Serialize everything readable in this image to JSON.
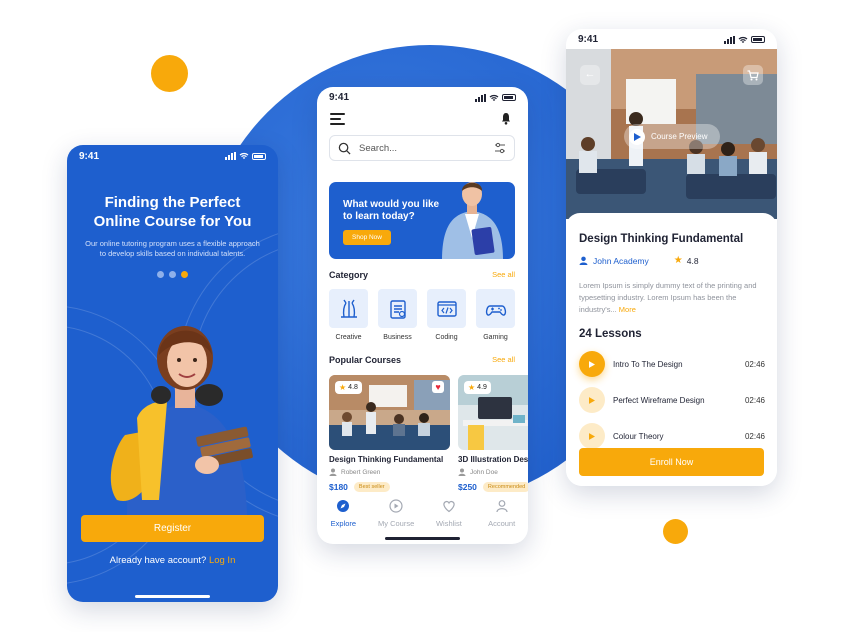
{
  "status_time": "9:41",
  "colors": {
    "brand_blue": "#1e5fce",
    "accent_orange": "#f8a90b"
  },
  "onboarding": {
    "title_line1": "Finding the Perfect",
    "title_line2": "Online Course for You",
    "description": "Our online tutoring program uses a flexible approach to develop skills based on individual talents.",
    "pager": {
      "count": 3,
      "active_index": 2
    },
    "register_label": "Register",
    "login_prompt": "Already have account?",
    "login_link": "Log In"
  },
  "explore": {
    "search_placeholder": "Search...",
    "banner": {
      "title": "What would you like to learn today?",
      "button": "Shop Now"
    },
    "category_title": "Category",
    "see_all": "See all",
    "categories": [
      {
        "label": "Creative",
        "icon": "palette-icon"
      },
      {
        "label": "Business",
        "icon": "briefcase-icon"
      },
      {
        "label": "Coding",
        "icon": "code-icon"
      },
      {
        "label": "Gaming",
        "icon": "gamepad-icon"
      }
    ],
    "popular_title": "Popular Courses",
    "courses": [
      {
        "title": "Design Thinking Fundamental",
        "author": "Robert Green",
        "price": "$180",
        "rating": "4.8",
        "tag": "Best seller"
      },
      {
        "title": "3D Illustration Design",
        "author": "John Doe",
        "price": "$250",
        "rating": "4.9",
        "tag": "Recommended"
      }
    ],
    "nav": [
      {
        "label": "Explore",
        "icon": "compass-icon"
      },
      {
        "label": "My Course",
        "icon": "play-circle-icon"
      },
      {
        "label": "Wishlist",
        "icon": "heart-icon"
      },
      {
        "label": "Account",
        "icon": "user-icon"
      }
    ]
  },
  "detail": {
    "preview_label": "Course Preview",
    "title": "Design Thinking Fundamental",
    "academy": "John Academy",
    "rating": "4.8",
    "description": "Lorem Ipsum is simply dummy text of the printing and typesetting industry. Lorem Ipsum has been the industry's...",
    "more": "More",
    "lessons_title": "24 Lessons",
    "lessons": [
      {
        "title": "Intro To The Design",
        "duration": "02:46"
      },
      {
        "title": "Perfect Wireframe Design",
        "duration": "02:46"
      },
      {
        "title": "Colour Theory",
        "duration": "02:46"
      }
    ],
    "enroll_label": "Enroll Now"
  }
}
